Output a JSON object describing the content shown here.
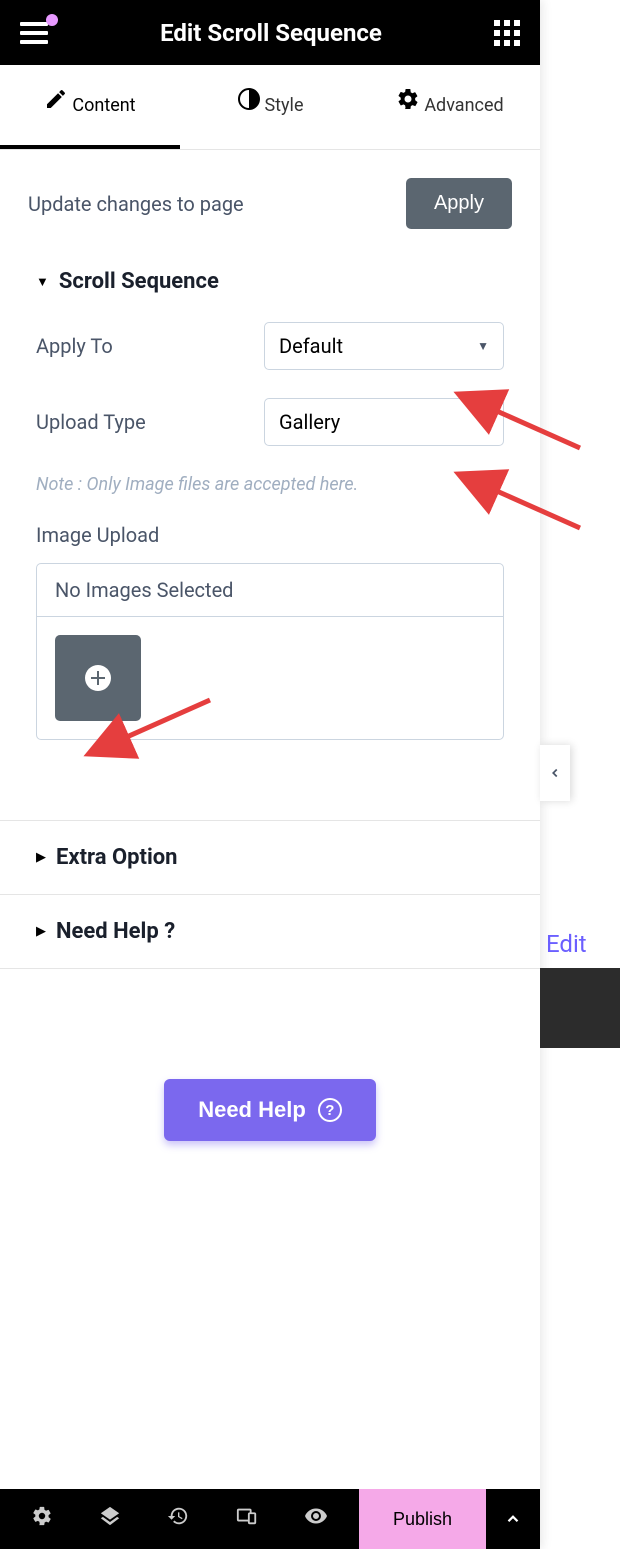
{
  "header": {
    "title": "Edit Scroll Sequence"
  },
  "tabs": [
    {
      "label": "Content",
      "active": true
    },
    {
      "label": "Style",
      "active": false
    },
    {
      "label": "Advanced",
      "active": false
    }
  ],
  "apply_row": {
    "text": "Update changes to page",
    "button": "Apply"
  },
  "section_scroll": {
    "title": "Scroll Sequence",
    "apply_to": {
      "label": "Apply To",
      "value": "Default"
    },
    "upload_type": {
      "label": "Upload Type",
      "value": "Gallery"
    },
    "note": "Note : Only Image files are accepted here.",
    "image_upload": {
      "label": "Image Upload",
      "empty_text": "No Images Selected"
    }
  },
  "section_extra": {
    "title": "Extra Option"
  },
  "section_help": {
    "title": "Need Help ?"
  },
  "need_help_button": "Need Help",
  "footer": {
    "publish": "Publish"
  },
  "side_text": "Edit"
}
